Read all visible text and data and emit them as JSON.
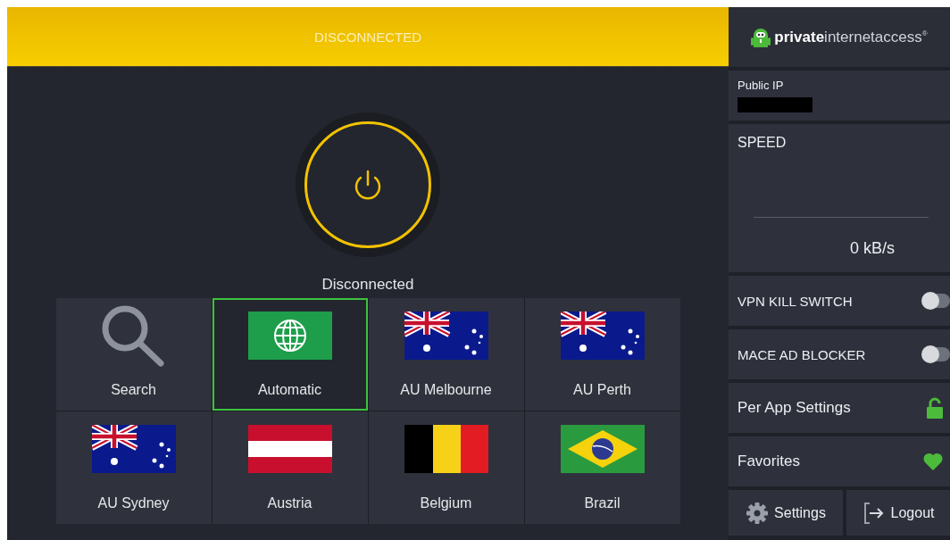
{
  "status_bar": {
    "label": "DISCONNECTED",
    "connected": false
  },
  "connection": {
    "status": "Disconnected"
  },
  "regions": [
    {
      "label": "Search",
      "kind": "search",
      "selected": false
    },
    {
      "label": "Automatic",
      "kind": "automatic",
      "selected": true
    },
    {
      "label": "AU Melbourne",
      "kind": "flag-au",
      "selected": false
    },
    {
      "label": "AU Perth",
      "kind": "flag-au",
      "selected": false
    },
    {
      "label": "AU Sydney",
      "kind": "flag-au",
      "selected": false
    },
    {
      "label": "Austria",
      "kind": "flag-at",
      "selected": false
    },
    {
      "label": "Belgium",
      "kind": "flag-be",
      "selected": false
    },
    {
      "label": "Brazil",
      "kind": "flag-br",
      "selected": false
    }
  ],
  "sidebar": {
    "logo": {
      "bold": "private",
      "rest": "internetaccess",
      "mark": "®"
    },
    "public_ip": {
      "label": "Public IP"
    },
    "speed": {
      "label": "SPEED",
      "reading": "0 kB/s"
    },
    "toggles": [
      {
        "label": "VPN KILL SWITCH",
        "on": false
      },
      {
        "label": "MACE AD BLOCKER",
        "on": false
      }
    ],
    "links": [
      {
        "label": "Per App Settings",
        "kind": "lock"
      },
      {
        "label": "Favorites",
        "kind": "heart"
      }
    ],
    "buttons": [
      {
        "label": "Settings",
        "kind": "settings"
      },
      {
        "label": "Logout",
        "kind": "logout"
      }
    ]
  }
}
